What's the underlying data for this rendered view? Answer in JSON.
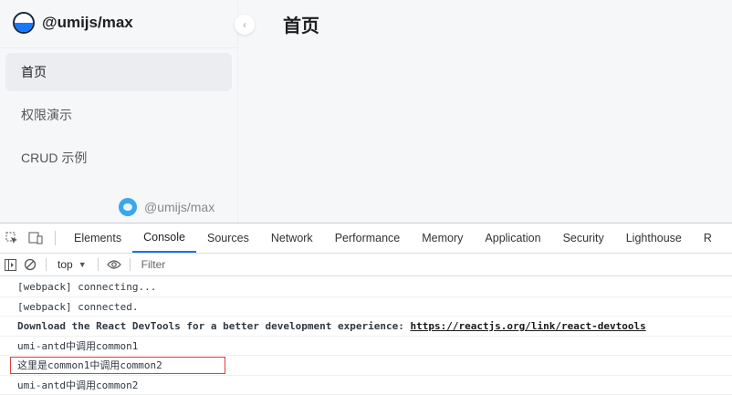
{
  "app": {
    "brand": "@umijs/max",
    "page_title": "首页",
    "menu": [
      {
        "label": "首页",
        "active": true
      },
      {
        "label": "权限演示",
        "active": false
      },
      {
        "label": "CRUD 示例",
        "active": false
      }
    ],
    "footer_text": "@umijs/max",
    "collapse_icon": "‹"
  },
  "devtools": {
    "tabs": [
      {
        "label": "Elements",
        "active": false
      },
      {
        "label": "Console",
        "active": true
      },
      {
        "label": "Sources",
        "active": false
      },
      {
        "label": "Network",
        "active": false
      },
      {
        "label": "Performance",
        "active": false
      },
      {
        "label": "Memory",
        "active": false
      },
      {
        "label": "Application",
        "active": false
      },
      {
        "label": "Security",
        "active": false
      },
      {
        "label": "Lighthouse",
        "active": false
      },
      {
        "label": "R",
        "active": false
      }
    ],
    "toolbar": {
      "context": "top",
      "filter_placeholder": "Filter"
    },
    "console_lines": [
      {
        "text": "[webpack] connecting...",
        "bold": false
      },
      {
        "text": "[webpack] connected.",
        "bold": false
      },
      {
        "text": "Download the React DevTools for a better development experience: ",
        "link": "https://reactjs.org/link/react-devtools",
        "bold": true
      },
      {
        "text": "umi-antd中调用common1",
        "bold": false
      },
      {
        "text": "这里是common1中调用common2",
        "bold": false,
        "highlighted": true
      },
      {
        "text": "umi-antd中调用common2",
        "bold": false
      }
    ]
  },
  "colors": {
    "accent": "#1a73e8",
    "highlight_border": "#e23c3c",
    "sider_bg": "#f6f7f9"
  }
}
